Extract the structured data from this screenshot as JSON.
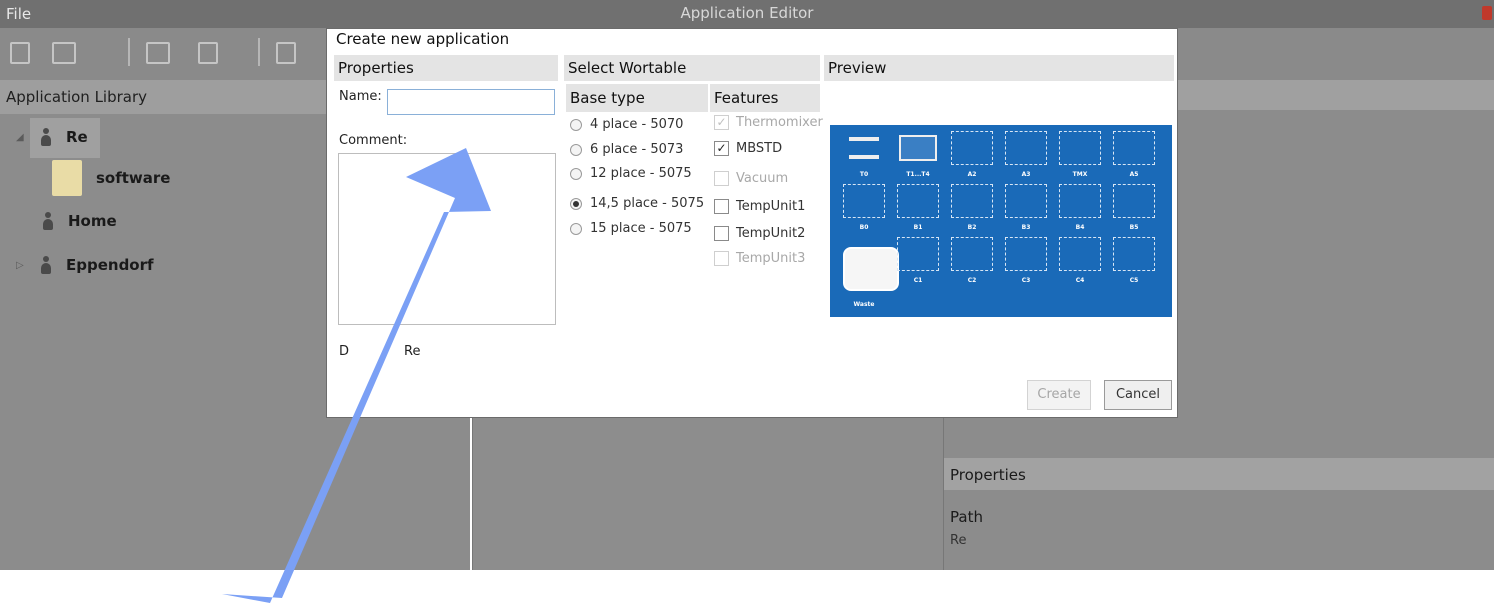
{
  "app": {
    "title": "Application Editor",
    "file_menu": "File"
  },
  "library": {
    "title": "Application Library",
    "tree": [
      {
        "label": "Re"
      },
      {
        "label": "software"
      },
      {
        "label": "Home"
      },
      {
        "label": "Eppendorf"
      }
    ]
  },
  "properties_panel": {
    "title": "Properties",
    "path_label": "Path",
    "path_value": "Re"
  },
  "dialog": {
    "title": "Create new application",
    "properties_header": "Properties",
    "name_label": "Name:",
    "name_value": "",
    "comment_label": "Comment:",
    "directory_label_visible": "D",
    "directory_value": "Re",
    "wortable_header": "Select Wortable",
    "base_type_header": "Base type",
    "features_header": "Features",
    "preview_header": "Preview",
    "base_types": [
      {
        "label": "4 place - 5070",
        "selected": false
      },
      {
        "label": "6 place - 5073",
        "selected": false
      },
      {
        "label": "12 place - 5075",
        "selected": false
      },
      {
        "label": "14,5 place - 5075",
        "selected": true
      },
      {
        "label": "15 place - 5075",
        "selected": false
      }
    ],
    "features": [
      {
        "label": "Thermomixer",
        "checked": true,
        "enabled": false
      },
      {
        "label": "MBSTD",
        "checked": true,
        "enabled": true
      },
      {
        "label": "Vacuum",
        "checked": false,
        "enabled": false
      },
      {
        "label": "TempUnit1",
        "checked": false,
        "enabled": true
      },
      {
        "label": "TempUnit2",
        "checked": false,
        "enabled": true
      },
      {
        "label": "TempUnit3",
        "checked": false,
        "enabled": false
      }
    ],
    "preview_slots": [
      "T0",
      "T1...T4",
      "A2",
      "A3",
      "TMX",
      "A5",
      "B0",
      "B1",
      "B2",
      "B3",
      "B4",
      "B5",
      "Waste",
      "C1",
      "C2",
      "C3",
      "C4",
      "C5"
    ],
    "preview_color": "#1a6ab8",
    "create_label": "Create",
    "cancel_label": "Cancel"
  },
  "annotation": {
    "arrow_color": "#7ba0f5"
  }
}
